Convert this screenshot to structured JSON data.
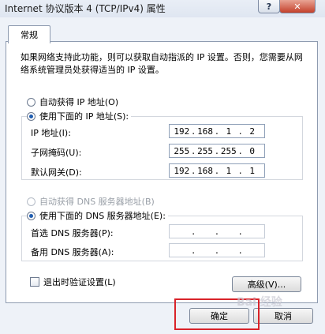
{
  "window": {
    "title": "Internet 协议版本 4 (TCP/IPv4) 属性",
    "help_label": "?",
    "close_label": "✕"
  },
  "tabs": [
    {
      "label": "常规"
    }
  ],
  "description": "如果网络支持此功能，则可以获取自动指派的 IP 设置。否则，您需要从网络系统管理员处获得适当的 IP 设置。",
  "ip_section": {
    "auto_label": "自动获得 IP 地址(O)",
    "manual_label": "使用下面的 IP 地址(S):",
    "fields": [
      {
        "label": "IP 地址(I):",
        "octets": [
          "192",
          "168",
          "1",
          "2"
        ]
      },
      {
        "label": "子网掩码(U):",
        "octets": [
          "255",
          "255",
          "255",
          "0"
        ]
      },
      {
        "label": "默认网关(D):",
        "octets": [
          "192",
          "168",
          "1",
          "1"
        ]
      }
    ]
  },
  "dns_section": {
    "auto_label": "自动获得 DNS 服务器地址(B)",
    "manual_label": "使用下面的 DNS 服务器地址(E):",
    "fields": [
      {
        "label": "首选 DNS 服务器(P):",
        "octets": [
          "",
          "",
          "",
          ""
        ]
      },
      {
        "label": "备用 DNS 服务器(A):",
        "octets": [
          "",
          "",
          "",
          ""
        ]
      }
    ]
  },
  "validate_label": "退出时验证设置(L)",
  "advanced_label": "高级(V)...",
  "ok_label": "确定",
  "cancel_label": "取消",
  "watermark": "Bai 经验"
}
